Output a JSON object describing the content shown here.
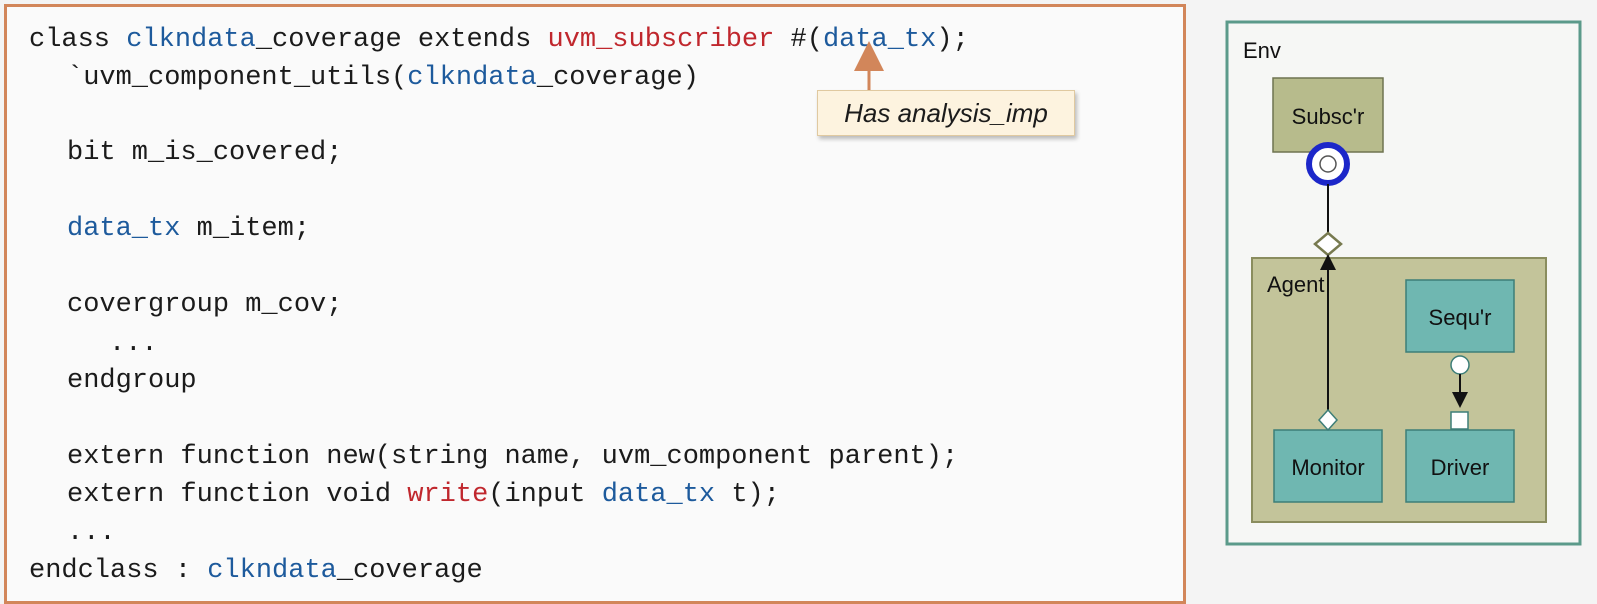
{
  "code": {
    "line1": {
      "kw1": "class ",
      "name": "clkndata",
      "rest1": "_coverage extends ",
      "base": "uvm_subscriber",
      "rest2": " #(",
      "param": "data_tx",
      "rest3": ");"
    },
    "line2": {
      "macro": "`uvm_component_utils(",
      "name": "clkndata",
      "rest": "_coverage)"
    },
    "line3": "bit m_is_covered;",
    "line4": {
      "type": "data_tx",
      "rest": " m_item;"
    },
    "line5": "covergroup m_cov;",
    "line6": "...",
    "line7": "endgroup",
    "line8": "extern function new(string name, uvm_component parent);",
    "line9": {
      "pre": "extern function void ",
      "fn": "write",
      "mid": "(input ",
      "type": "data_tx",
      "rest": " t);"
    },
    "line10": "...",
    "line11": {
      "kw": "endclass : ",
      "name": "clkndata",
      "rest": "_coverage"
    }
  },
  "callout": {
    "text": "Has analysis_imp"
  },
  "diagram": {
    "env_label": "Env",
    "agent_label": "Agent",
    "subscriber_label": "Subsc'r",
    "sequencer_label": "Sequ'r",
    "monitor_label": "Monitor",
    "driver_label": "Driver"
  },
  "colors": {
    "code_border": "#d2865a",
    "keyword_red": "#c0272d",
    "keyword_blue": "#1d5a9c",
    "env_border": "#5b9a8a",
    "agent_fill": "#c3c49a",
    "subscriber_fill": "#b7bb8c",
    "component_fill": "#6fb7b1",
    "analysis_imp_ring": "#1c27c9"
  }
}
